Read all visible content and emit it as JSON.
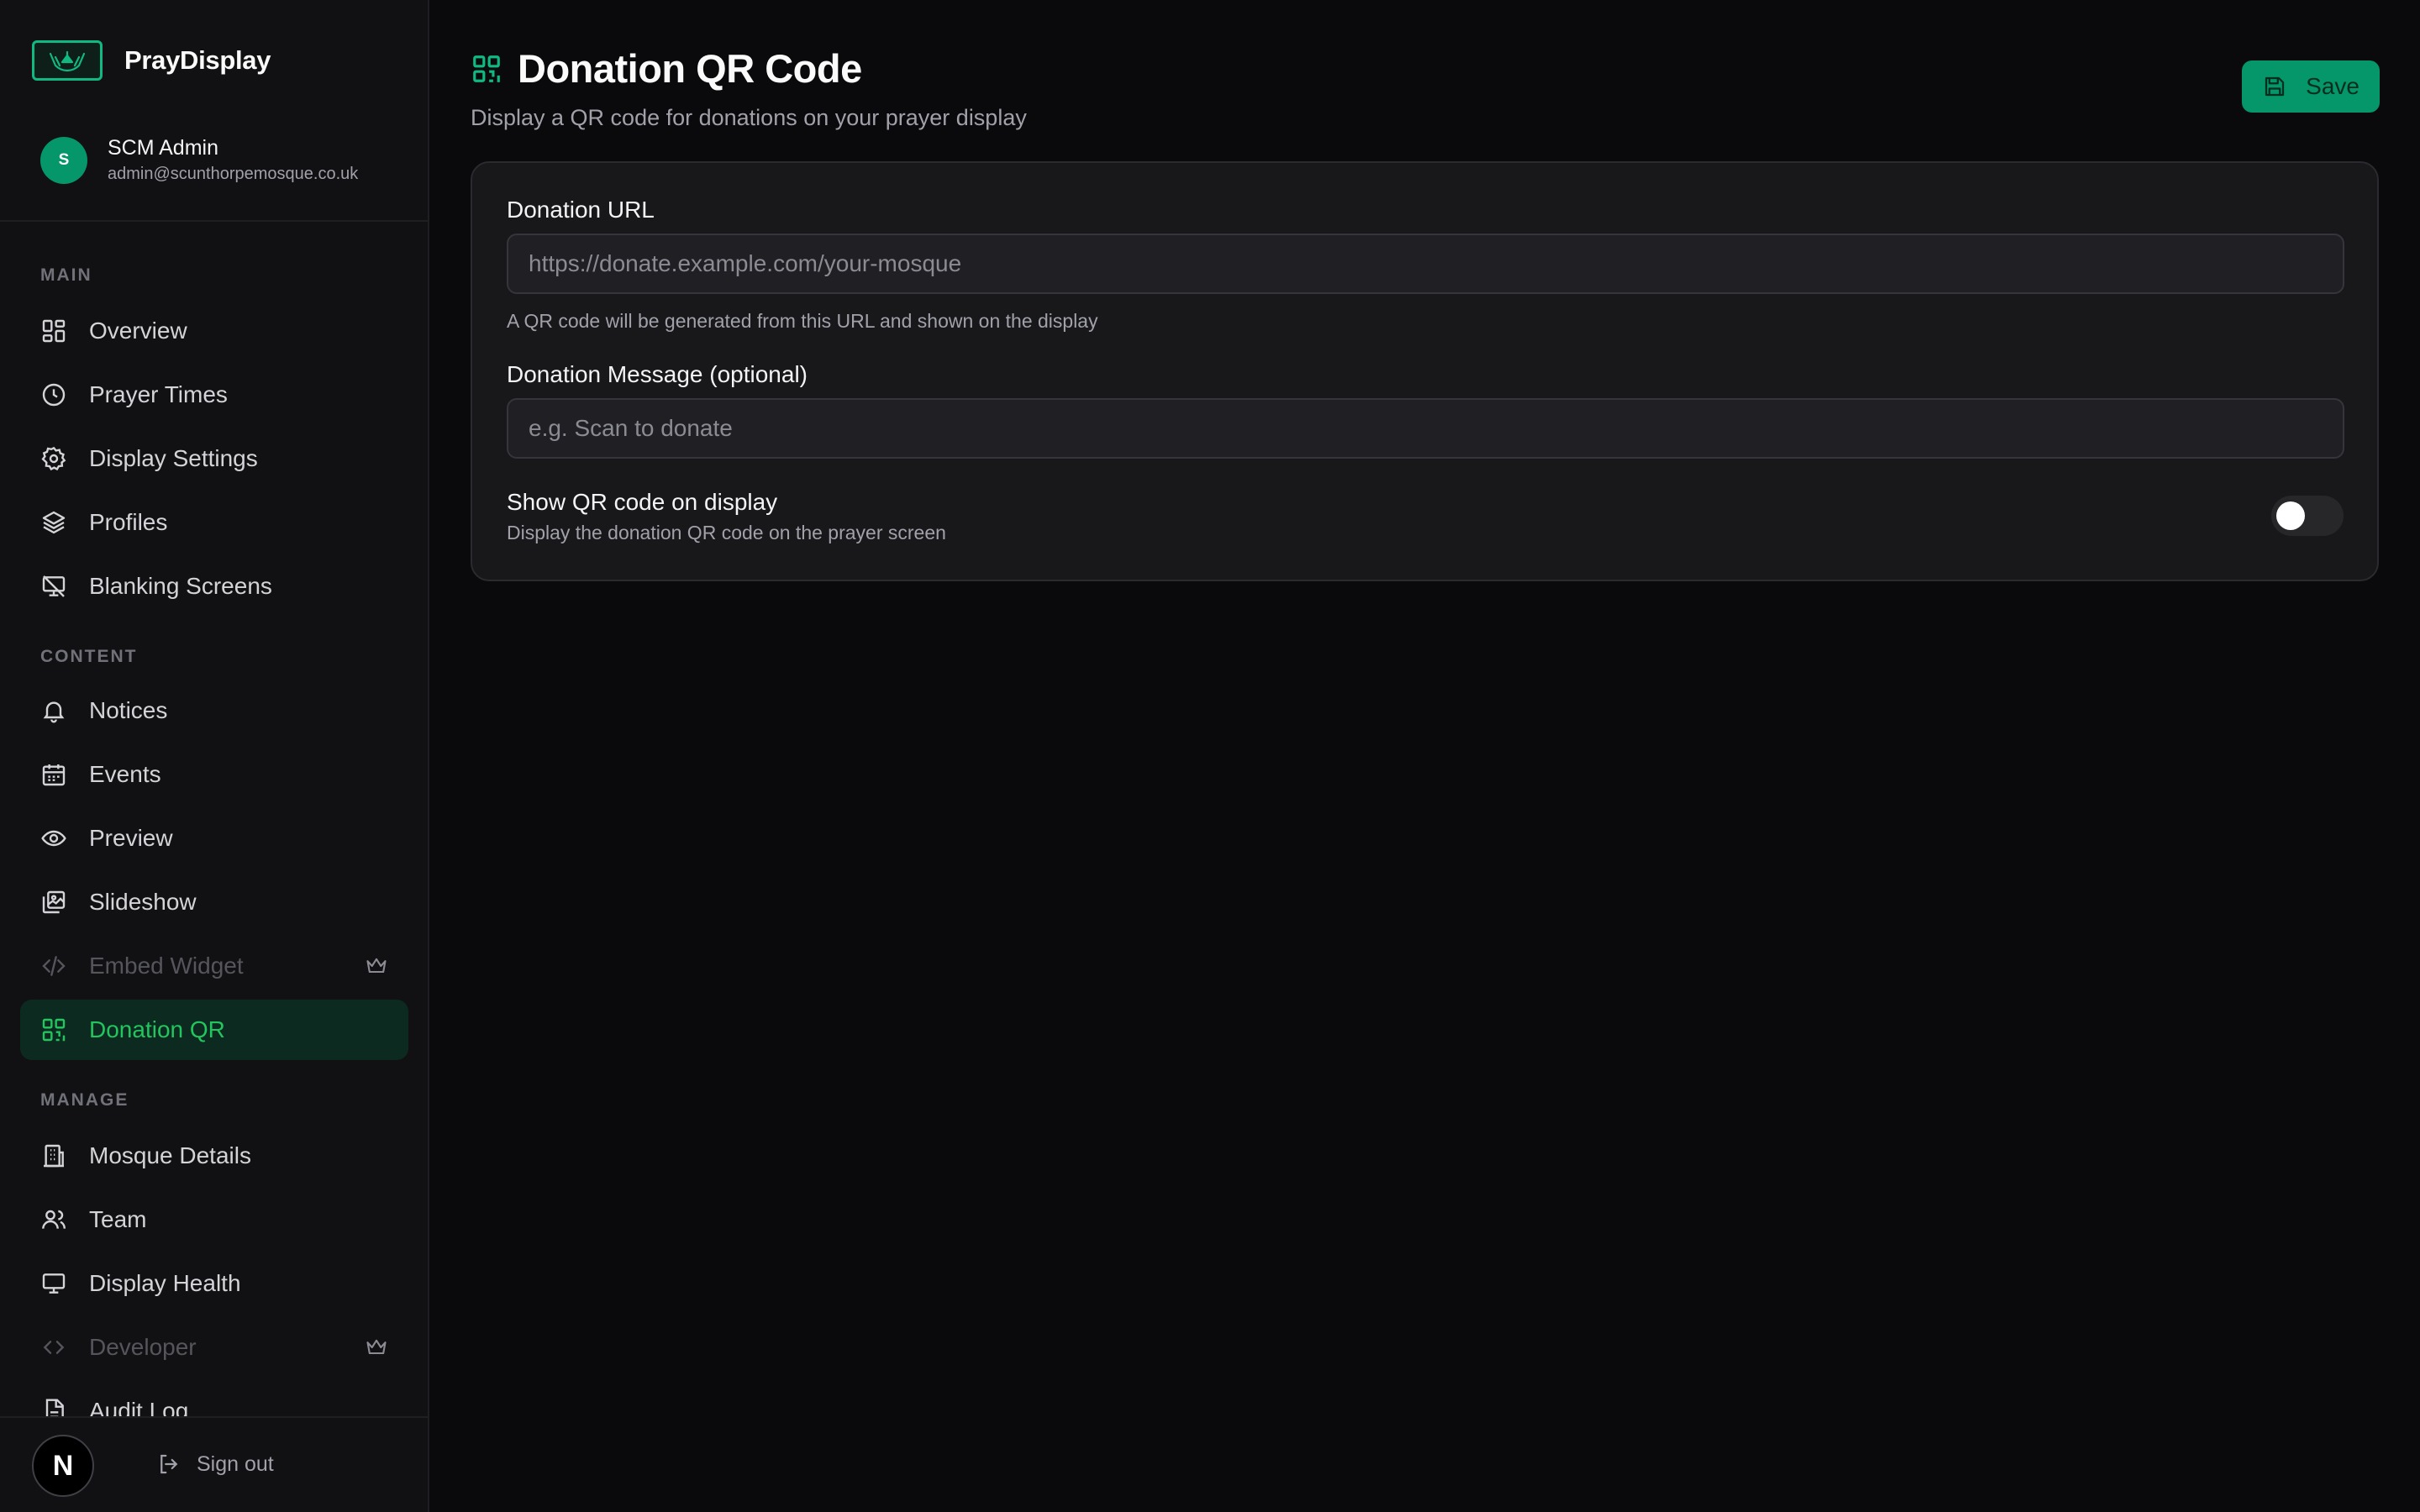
{
  "app": {
    "name": "PrayDisplay"
  },
  "user": {
    "initial": "S",
    "name": "SCM Admin",
    "email": "admin@scunthorpemosque.co.uk"
  },
  "sidebar": {
    "sections": [
      {
        "label": "MAIN",
        "items": [
          {
            "label": "Overview",
            "icon": "dashboard-icon"
          },
          {
            "label": "Prayer Times",
            "icon": "clock-icon"
          },
          {
            "label": "Display Settings",
            "icon": "gear-icon"
          },
          {
            "label": "Profiles",
            "icon": "layers-icon"
          },
          {
            "label": "Blanking Screens",
            "icon": "monitor-off-icon"
          }
        ]
      },
      {
        "label": "CONTENT",
        "items": [
          {
            "label": "Notices",
            "icon": "bell-icon"
          },
          {
            "label": "Events",
            "icon": "calendar-icon"
          },
          {
            "label": "Preview",
            "icon": "eye-icon"
          },
          {
            "label": "Slideshow",
            "icon": "images-icon"
          },
          {
            "label": "Embed Widget",
            "icon": "code-icon",
            "disabled": true,
            "premium": true
          },
          {
            "label": "Donation QR",
            "icon": "qr-code-icon",
            "active": true
          }
        ]
      },
      {
        "label": "MANAGE",
        "items": [
          {
            "label": "Mosque Details",
            "icon": "building-icon"
          },
          {
            "label": "Team",
            "icon": "users-icon"
          },
          {
            "label": "Display Health",
            "icon": "monitor-icon"
          },
          {
            "label": "Developer",
            "icon": "code-icon",
            "disabled": true,
            "premium": true
          },
          {
            "label": "Audit Log",
            "icon": "file-text-icon"
          }
        ]
      }
    ],
    "footer": {
      "badge": "N",
      "signout_label": "Sign out"
    }
  },
  "page": {
    "title": "Donation QR Code",
    "subtitle": "Display a QR code for donations on your prayer display",
    "save_label": "Save"
  },
  "form": {
    "url_label": "Donation URL",
    "url_placeholder": "https://donate.example.com/your-mosque",
    "url_value": "",
    "url_help": "A QR code will be generated from this URL and shown on the display",
    "message_label": "Donation Message (optional)",
    "message_placeholder": "e.g. Scan to donate",
    "message_value": "",
    "toggle_title": "Show QR code on display",
    "toggle_desc": "Display the donation QR code on the prayer screen",
    "toggle_on": false
  },
  "colors": {
    "accent": "#10b981",
    "active_bg": "#0d2a20",
    "save_bg": "#059669"
  }
}
